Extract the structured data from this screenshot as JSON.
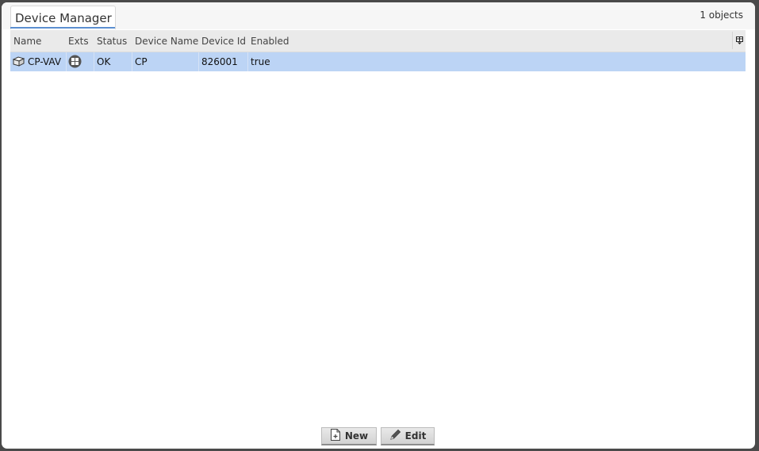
{
  "tab": {
    "label": "Device Manager"
  },
  "object_count": "1 objects",
  "columns": [
    "Name",
    "Exts",
    "Status",
    "Device Name",
    "Device Id",
    "Enabled"
  ],
  "rows": [
    {
      "name": "CP-VAV",
      "status": "OK",
      "device_name": "CP",
      "device_id": "826001",
      "enabled": "true"
    }
  ],
  "buttons": {
    "new_label": "New",
    "edit_label": "Edit"
  },
  "icons": {
    "row_name": "device-icon",
    "row_exts": "device-extensions-icon",
    "column_chooser": "column-chooser-icon",
    "new": "new-document-icon",
    "edit": "pencil-icon"
  },
  "colors": {
    "selected_row": "#bcd4f5",
    "tab_accent": "#5b8fd0",
    "header": "#eaeaea"
  }
}
